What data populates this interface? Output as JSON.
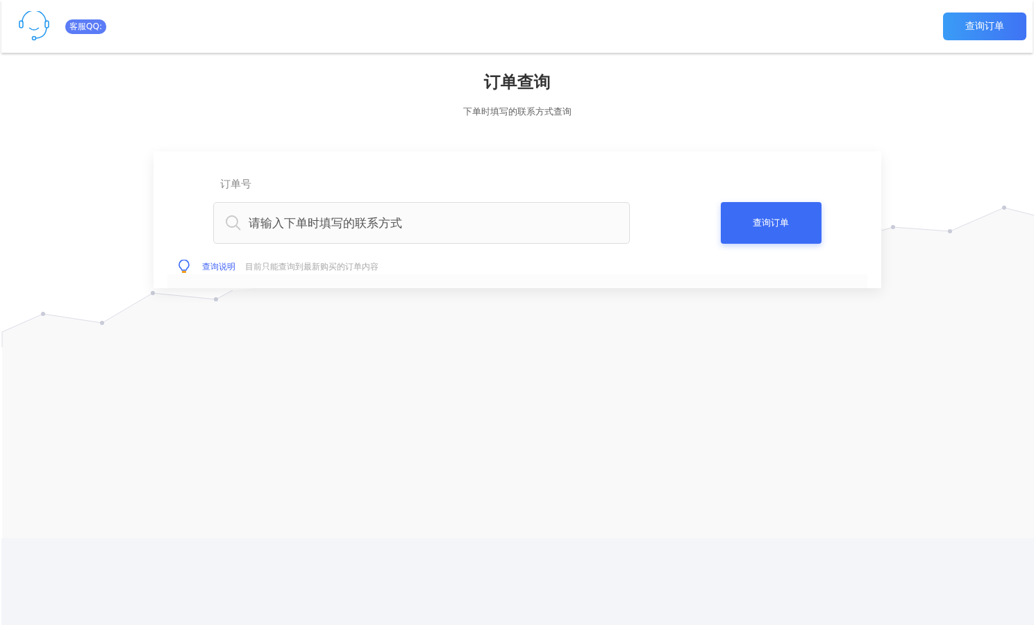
{
  "header": {
    "badge": "客服QQ:",
    "button": "查询订单"
  },
  "title": "订单查询",
  "subtitle": "下单时填写的联系方式查询",
  "form": {
    "label": "订单号",
    "placeholder": "请输入下单时填写的联系方式",
    "button": "查询订单",
    "tip_label": "查询说明",
    "tip_text": "目前只能查询到最新购买的订单内容"
  }
}
